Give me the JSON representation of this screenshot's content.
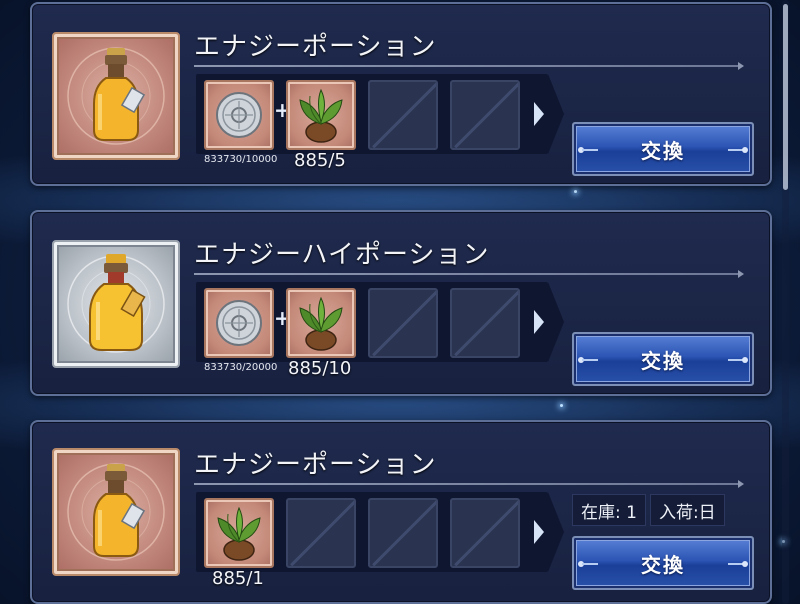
{
  "items": [
    {
      "name": "エナジーポーション",
      "frame": "rose",
      "materials": [
        {
          "icon": "silver-coin-icon",
          "count": "833730/10000"
        },
        {
          "icon": "herb-pot-icon",
          "count": "885/5"
        }
      ],
      "exchange_label": "交換"
    },
    {
      "name": "エナジーハイポーション",
      "frame": "silver",
      "materials": [
        {
          "icon": "silver-coin-icon",
          "count": "833730/20000"
        },
        {
          "icon": "herb-pot-icon",
          "count": "885/10"
        }
      ],
      "exchange_label": "交換"
    },
    {
      "name": "エナジーポーション",
      "frame": "rose",
      "materials": [
        {
          "icon": "herb-pot-icon",
          "count": "885/1"
        }
      ],
      "stock_label": "在庫: 1",
      "restock_label": "入荷:日",
      "exchange_label": "交換"
    }
  ],
  "colors": {
    "button_blue": "#2c55b4",
    "card_bg": "#1f2a4e",
    "rose_frame": "#c0857a",
    "silver_frame": "#b8bfc6"
  }
}
